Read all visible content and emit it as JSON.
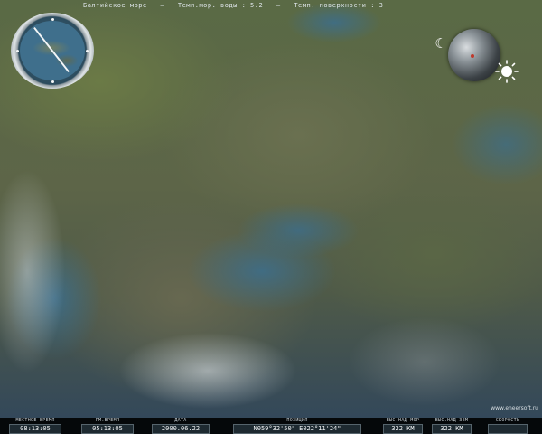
{
  "topbar": {
    "region": "Балтийское море",
    "water_temp_label": "Темп.мор. воды :",
    "water_temp_value": "5.2",
    "surface_temp_label": "Темп. поверхности :",
    "surface_temp_value": "3"
  },
  "status": {
    "local_time_label": "МЕСТНОЕ ВРЕМЯ",
    "local_time_value": "08:13:05",
    "gm_time_label": "ГМ.ВРЕМЯ",
    "gm_time_value": "05:13:05",
    "date_label": "ДАТА",
    "date_value": "2000.06.22",
    "position_label": "ПОЗИЦИЯ",
    "position_value": "N059°32'50\" E022°11'24\"",
    "sea_altitude_label": "ВЫС.НАД МОР",
    "sea_altitude_value": "322 KM",
    "ground_altitude_label": "ВЫС.НАД ЗЕМ",
    "ground_altitude_value": "322 KM",
    "speed_label": "СКОРОСТЬ",
    "speed_value": ""
  },
  "watermark": "www.eneersoft.ru",
  "icons": {
    "compass": "compass-icon",
    "moon": "moon-icon",
    "globe": "globe-icon",
    "sun": "sun-icon"
  },
  "colors": {
    "status_bg": "#05080a",
    "value_box": "#1e2a31",
    "sea": "#3f6f8c",
    "land": "#5d6548"
  }
}
